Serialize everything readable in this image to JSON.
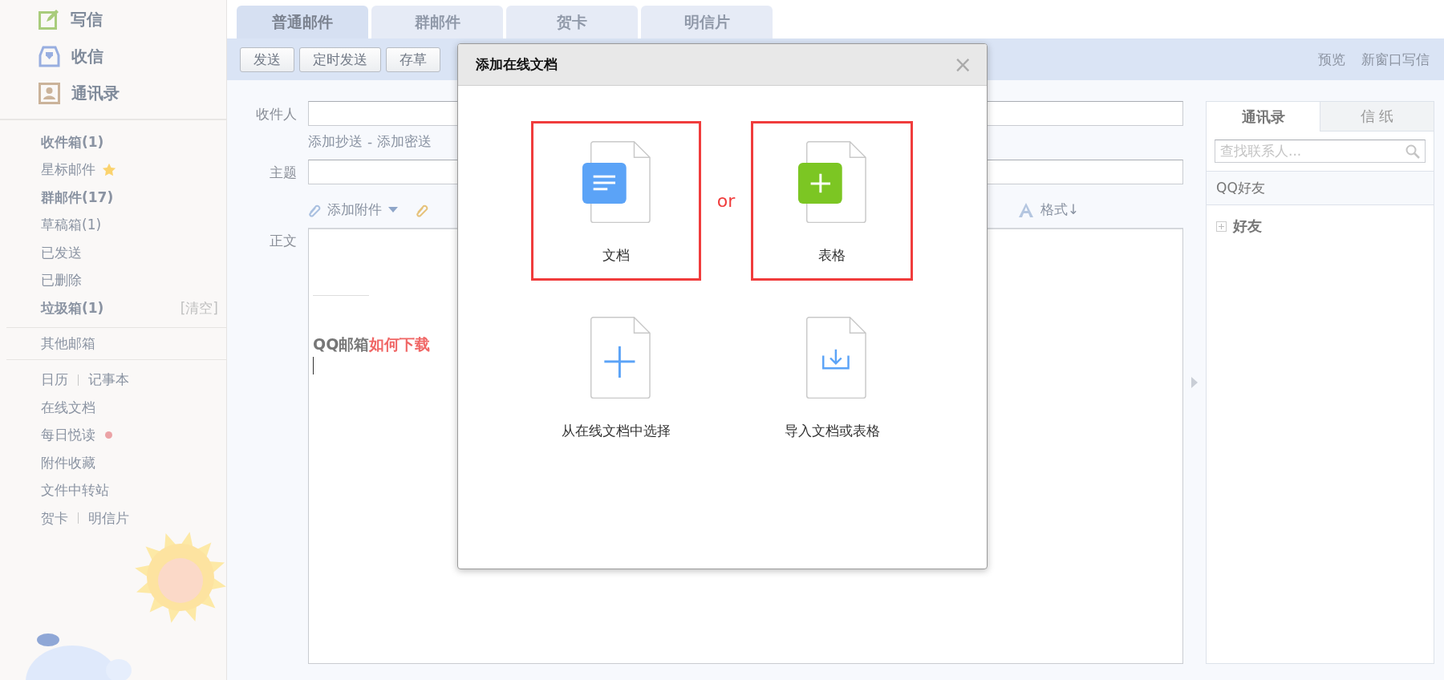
{
  "sidebar": {
    "actions": [
      {
        "kind": "compose",
        "label": "写信"
      },
      {
        "kind": "inbox",
        "label": "收信"
      },
      {
        "kind": "contacts",
        "label": "通讯录"
      }
    ],
    "folders": [
      {
        "label": "收件箱(1)",
        "bold": true,
        "starred": false
      },
      {
        "label": "星标邮件",
        "bold": false,
        "starred": true
      },
      {
        "label": "群邮件(17)",
        "bold": true,
        "starred": false
      },
      {
        "label": "草稿箱(1)",
        "bold": false,
        "starred": false
      },
      {
        "label": "已发送",
        "bold": false,
        "starred": false
      },
      {
        "label": "已删除",
        "bold": false,
        "starred": false
      },
      {
        "label": "垃圾箱(1)",
        "bold": true,
        "starred": false,
        "action": "[清空]"
      }
    ],
    "other_mailboxes": "其他邮箱",
    "tools": [
      {
        "links": [
          "日历",
          "记事本"
        ],
        "unread_dot": false
      },
      {
        "links": [
          "在线文档"
        ],
        "unread_dot": false
      },
      {
        "links": [
          "每日悦读"
        ],
        "unread_dot": true
      },
      {
        "links": [
          "附件收藏"
        ],
        "unread_dot": false
      },
      {
        "links": [
          "文件中转站"
        ],
        "unread_dot": false
      },
      {
        "links": [
          "贺卡",
          "明信片"
        ],
        "unread_dot": false
      }
    ]
  },
  "tabs": [
    {
      "label": "普通邮件",
      "selected": true
    },
    {
      "label": "群邮件",
      "selected": false
    },
    {
      "label": "贺卡",
      "selected": false
    },
    {
      "label": "明信片",
      "selected": false
    }
  ],
  "toolbar": {
    "buttons": [
      "发送",
      "定时发送",
      "存草"
    ],
    "links": [
      "预览",
      "新窗口写信"
    ]
  },
  "compose": {
    "recipient_label": "收件人",
    "cc_links": [
      "添加抄送",
      "添加密送"
    ],
    "cc_separator": "-",
    "subject_label": "主题",
    "attach_label": "添加附件",
    "format_label": "格式↓",
    "body_label": "正文",
    "body_prefix": "QQ邮箱",
    "body_highlight": "如何下载"
  },
  "contacts_panel": {
    "tabs": [
      {
        "label": "通讯录",
        "selected": true
      },
      {
        "label": "信 纸",
        "selected": false
      }
    ],
    "search_placeholder": "查找联系人...",
    "section": "QQ好友",
    "groups": [
      {
        "label": "好友",
        "expanded": false
      }
    ]
  },
  "dialog": {
    "title": "添加在线文档",
    "close": "×",
    "or_label": "or",
    "options": [
      {
        "kind": "doc",
        "label": "文档",
        "highlighted": true
      },
      {
        "kind": "sheet",
        "label": "表格",
        "highlighted": true
      },
      {
        "kind": "pick",
        "label": "从在线文档中选择",
        "highlighted": false
      },
      {
        "kind": "import",
        "label": "导入文档或表格",
        "highlighted": false
      }
    ]
  }
}
